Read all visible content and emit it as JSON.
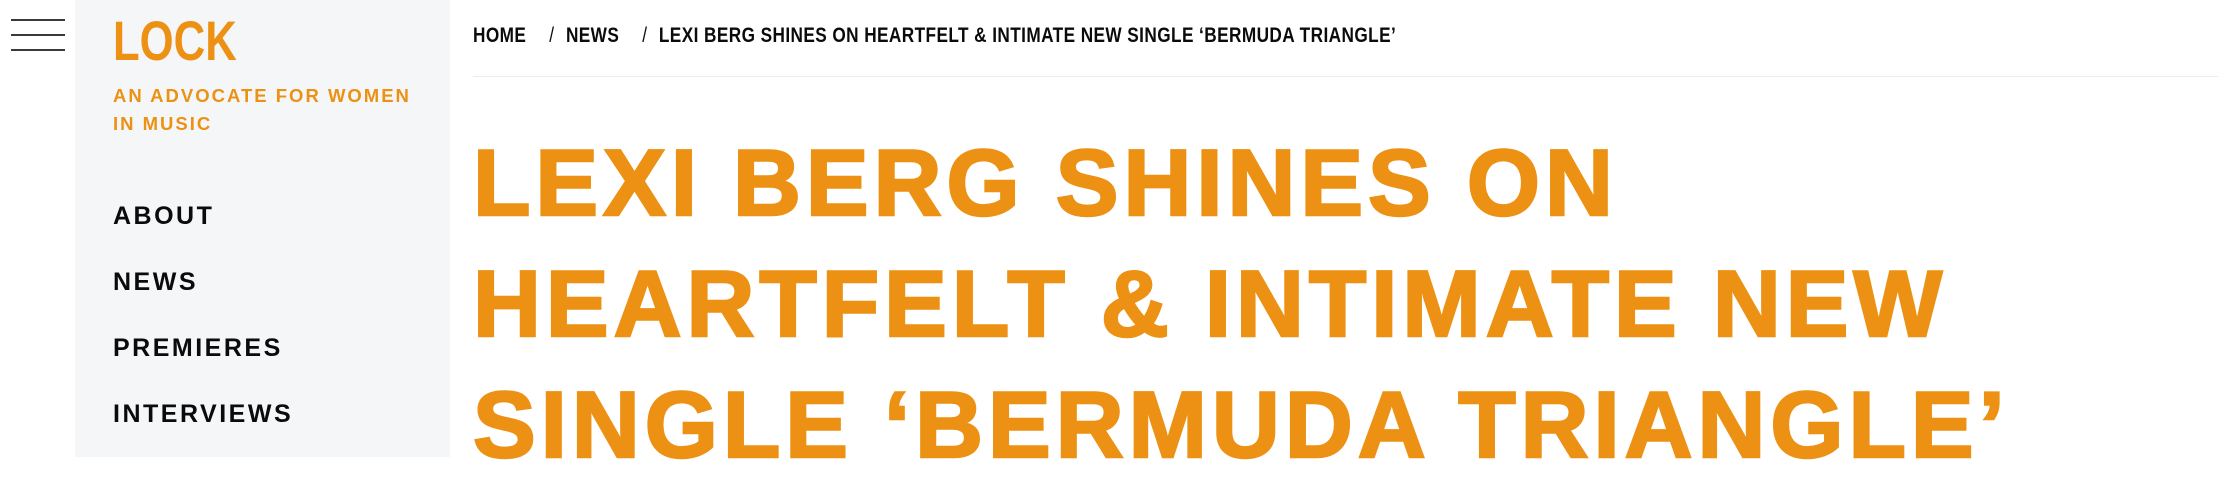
{
  "site": {
    "logo": "LOCK",
    "tagline": "AN ADVOCATE FOR WOMEN IN MUSIC"
  },
  "nav": {
    "items": [
      {
        "label": "ABOUT"
      },
      {
        "label": "NEWS"
      },
      {
        "label": "PREMIERES"
      },
      {
        "label": "INTERVIEWS"
      }
    ]
  },
  "breadcrumb": {
    "home": "HOME",
    "section": "NEWS",
    "current": "LEXI BERG SHINES ON HEARTFELT & INTIMATE NEW SINGLE ‘BERMUDA TRIANGLE’",
    "separator": "/"
  },
  "article": {
    "title": "LEXI BERG SHINES ON HEARTFELT & INTIMATE NEW SINGLE ‘BERMUDA TRIANGLE’"
  },
  "colors": {
    "accent": "#ec9113",
    "sidebar_bg": "#f5f6f8",
    "text": "#0b0b0b"
  },
  "icons": {
    "menu": "hamburger-menu-icon"
  }
}
